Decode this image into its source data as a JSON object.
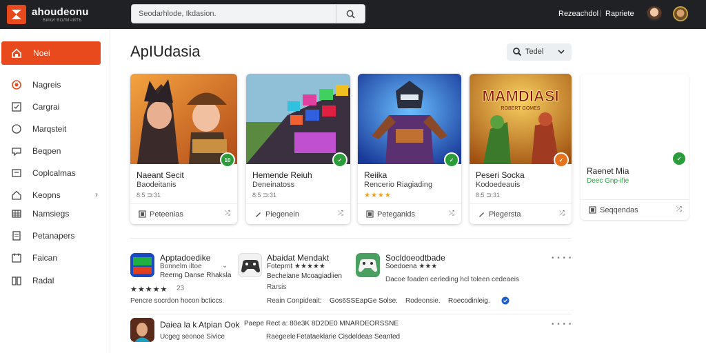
{
  "app": {
    "brand": "ahoudeonu",
    "brand_sub": "ВИКИ ВОЛИЧИТЬ",
    "search_placeholder": "Seodarhlode, Ikdasion.",
    "top_links": [
      "Rezeachdol",
      "Rapriete"
    ],
    "top_sep": "|"
  },
  "sidebar": {
    "home": "Noei",
    "items": [
      {
        "label": "Nagreis",
        "icon": "target-icon"
      },
      {
        "label": "Cargrai",
        "icon": "checkbox-icon"
      },
      {
        "label": "Marqsteit",
        "icon": "circle-icon"
      },
      {
        "label": "Beqpen",
        "icon": "chat-icon"
      },
      {
        "label": "Coplcalmas",
        "icon": "box-icon"
      },
      {
        "label": "Keopns",
        "icon": "home-icon",
        "arrow": "›"
      },
      {
        "label": "Namsiegs",
        "icon": "grid-icon"
      },
      {
        "label": "Petanapers",
        "icon": "document-icon"
      },
      {
        "label": "Faican",
        "icon": "calendar-icon"
      },
      {
        "label": "Radal",
        "icon": "book-icon"
      }
    ]
  },
  "main": {
    "title": "ApIUdasia",
    "sort_label": "Tedel",
    "cards": [
      {
        "title": "Naeant Secit",
        "sub": "Baodeitanis",
        "meta": "8:5 ⊐:31",
        "badge": "10",
        "foot": "Peteenias",
        "share": "⤮"
      },
      {
        "title": "Hemende Reiuh",
        "sub": "Deneinatoss",
        "meta": "8:5 ⊐:31",
        "badge": "✓",
        "foot": "Piegenein",
        "share": "⤮"
      },
      {
        "title": "Reiika",
        "sub": "Rencerio Riagiading",
        "stars": "★★★★",
        "badge": "✓",
        "foot": "Peteganids",
        "share": "⤮"
      },
      {
        "title": "Peseri Socka",
        "sub": "Kodoedeauis",
        "meta": "8:5 ⊐:31",
        "badge": "✓",
        "foot": "Piegersta",
        "share": "⤮",
        "art_text": "MAMDIASI",
        "art_sub": "ROBERT GOMES"
      },
      {
        "title": "Raenet Mia",
        "sub": "Deec Gnp-ifie",
        "badge": "✓",
        "foot": "Seqqendas",
        "share": "⤮"
      }
    ],
    "list": [
      {
        "title": "Apptadoedike",
        "line1": "Bonnelm iltoe",
        "line2": "Reerng Danse Rhaksla",
        "stars": "★★★★★",
        "rating": "23",
        "desc": "Pencre socrdon hocon bcticcs.",
        "chev": "⌄"
      },
      {
        "title": "Abaidat Mendakt",
        "line1": "Foteprnt ★★★★★",
        "line2": "Becheiane Mcoagiadiien",
        "line3": "Rarsis",
        "desc_pre": "Reain Conpideait:",
        "desc_a": "Gos6SSEapGe Solse.",
        "desc_b": "Rodeonsie.",
        "desc_c": "Roecodinleig."
      },
      {
        "title": "Socldoeodtbade",
        "line1": "Soedoena ★★★",
        "desc": "Dacoe foaden cerleding hcl toleen cedeaeis",
        "dots": "• • • •"
      },
      {
        "title": "Daiea la k Atpian Ook",
        "line1": "Ucgeg seonoe Sivice",
        "green": "Paepe Rect a: 80e3K 8D2DE0 MNARDEORSSNE",
        "pre": "Raegeele",
        "blue": "Fetataeklarie Cisdeldeas Seanted",
        "dots": "• • • •"
      }
    ],
    "list_dots": "• • • •"
  },
  "colors": {
    "accent": "#e8491d",
    "topbar": "#202124",
    "badge": "#2a9d3a"
  }
}
